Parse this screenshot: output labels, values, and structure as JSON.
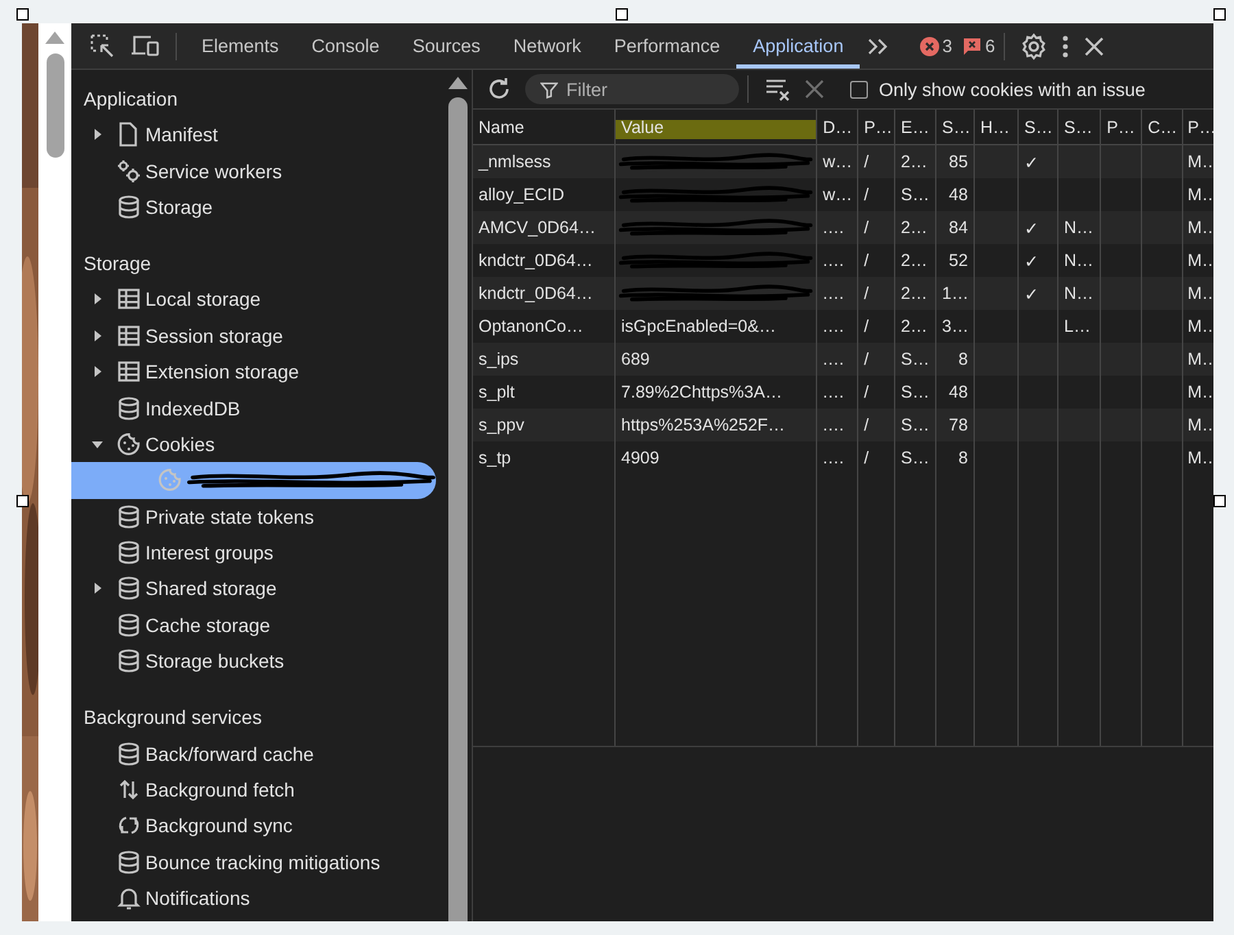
{
  "tabs": [
    {
      "label": "Elements",
      "selected": false
    },
    {
      "label": "Console",
      "selected": false
    },
    {
      "label": "Sources",
      "selected": false
    },
    {
      "label": "Network",
      "selected": false
    },
    {
      "label": "Performance",
      "selected": false
    },
    {
      "label": "Application",
      "selected": true
    }
  ],
  "issue_counts": {
    "errors": "3",
    "warnings": "6"
  },
  "sidebar": {
    "sections": [
      {
        "title": "Application",
        "items": [
          {
            "label": "Manifest",
            "kind": "file",
            "expanded": false,
            "selected": false
          },
          {
            "label": "Service workers",
            "kind": "gears",
            "selected": false
          },
          {
            "label": "Storage",
            "kind": "database",
            "selected": false
          }
        ]
      },
      {
        "title": "Storage",
        "items": [
          {
            "label": "Local storage",
            "kind": "table",
            "expanded": false,
            "selected": false
          },
          {
            "label": "Session storage",
            "kind": "table",
            "expanded": false,
            "selected": false
          },
          {
            "label": "Extension storage",
            "kind": "table",
            "expanded": false,
            "selected": false
          },
          {
            "label": "IndexedDB",
            "kind": "database",
            "selected": false
          },
          {
            "label": "Cookies",
            "kind": "cookie",
            "expanded": true,
            "selected": false,
            "children": [
              {
                "kind": "cookie",
                "redacted": true,
                "selected": true
              }
            ]
          },
          {
            "label": "Private state tokens",
            "kind": "database",
            "selected": false
          },
          {
            "label": "Interest groups",
            "kind": "database",
            "selected": false
          },
          {
            "label": "Shared storage",
            "kind": "database",
            "expanded": false,
            "selected": false
          },
          {
            "label": "Cache storage",
            "kind": "database",
            "selected": false
          },
          {
            "label": "Storage buckets",
            "kind": "database",
            "selected": false
          }
        ]
      },
      {
        "title": "Background services",
        "items": [
          {
            "label": "Back/forward cache",
            "kind": "database",
            "selected": false
          },
          {
            "label": "Background fetch",
            "kind": "updown",
            "selected": false
          },
          {
            "label": "Background sync",
            "kind": "sync",
            "selected": false
          },
          {
            "label": "Bounce tracking mitigations",
            "kind": "database",
            "selected": false
          },
          {
            "label": "Notifications",
            "kind": "bell",
            "selected": false
          }
        ]
      }
    ]
  },
  "cookie_toolbar": {
    "filter": {
      "placeholder": "Filter"
    },
    "only_issues": {
      "label": "Only show cookies with an issue",
      "checked": false
    }
  },
  "table": {
    "columns": [
      {
        "label": "Name"
      },
      {
        "label": "Value",
        "highlighted": true
      },
      {
        "label": "D…"
      },
      {
        "label": "P…"
      },
      {
        "label": "E…"
      },
      {
        "label": "S…"
      },
      {
        "label": "H…"
      },
      {
        "label": "S…"
      },
      {
        "label": "S…"
      },
      {
        "label": "P…"
      },
      {
        "label": "C…"
      },
      {
        "label": "P…"
      }
    ],
    "rows": [
      {
        "cells": [
          "_nmlsess",
          {
            "redacted": true
          },
          "w…",
          "/",
          "2…",
          "85",
          null,
          "✓",
          null,
          null,
          null,
          "M…"
        ]
      },
      {
        "cells": [
          "alloy_ECID",
          {
            "redacted": true
          },
          "w…",
          "/",
          "S…",
          "48",
          null,
          null,
          null,
          null,
          null,
          "M…"
        ]
      },
      {
        "cells": [
          "AMCV_0D64…",
          {
            "redacted": true
          },
          ".…",
          "/",
          "2…",
          "84",
          null,
          "✓",
          "N…",
          null,
          null,
          "M…"
        ]
      },
      {
        "cells": [
          "kndctr_0D64…",
          {
            "redacted": true
          },
          ".…",
          "/",
          "2…",
          "52",
          null,
          "✓",
          "N…",
          null,
          null,
          "M…"
        ]
      },
      {
        "cells": [
          "kndctr_0D64…",
          {
            "redacted": true
          },
          ".…",
          "/",
          "2…",
          "1…",
          null,
          "✓",
          "N…",
          null,
          null,
          "M…"
        ]
      },
      {
        "cells": [
          "OptanonCo…",
          "isGpcEnabled=0&…",
          ".…",
          "/",
          "2…",
          "3…",
          null,
          null,
          "L…",
          null,
          null,
          "M…"
        ]
      },
      {
        "cells": [
          "s_ips",
          "689",
          ".…",
          "/",
          "S…",
          "8",
          null,
          null,
          null,
          null,
          null,
          "M…"
        ]
      },
      {
        "cells": [
          "s_plt",
          "7.89%2Chttps%3A…",
          ".…",
          "/",
          "S…",
          "48",
          null,
          null,
          null,
          null,
          null,
          "M…"
        ]
      },
      {
        "cells": [
          "s_ppv",
          "https%253A%252F…",
          ".…",
          "/",
          "S…",
          "78",
          null,
          null,
          null,
          null,
          null,
          "M…"
        ]
      },
      {
        "cells": [
          "s_tp",
          "4909",
          ".…",
          "/",
          "S…",
          "8",
          null,
          null,
          null,
          null,
          null,
          "M…"
        ]
      }
    ]
  }
}
